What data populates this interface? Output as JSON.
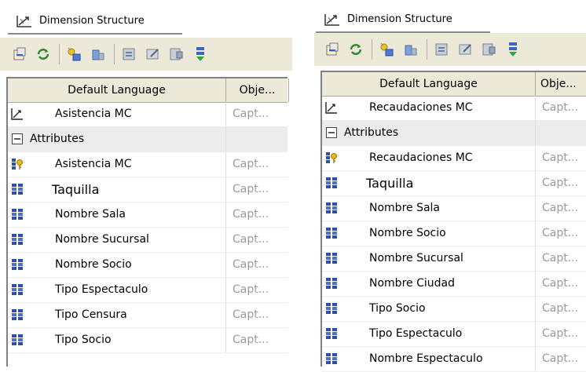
{
  "panels": [
    {
      "tab_title": "Dimension Structure",
      "headers": [
        "Default Language",
        "Obje..."
      ],
      "rows": [
        {
          "type": "dimension",
          "icon": "dimension-icon",
          "label": "Asistencia MC",
          "value": "Capt..."
        },
        {
          "type": "group",
          "icon": "collapse-icon",
          "label": "Attributes",
          "value": ""
        },
        {
          "type": "key",
          "icon": "key-attribute-icon",
          "label": "Asistencia MC",
          "value": "Capt..."
        },
        {
          "type": "attr",
          "icon": "attribute-icon",
          "label": "Taquilla",
          "value": "Capt..."
        },
        {
          "type": "attr",
          "icon": "attribute-icon",
          "label": "Nombre Sala",
          "value": "Capt..."
        },
        {
          "type": "attr",
          "icon": "attribute-icon",
          "label": "Nombre Sucursal",
          "value": "Capt..."
        },
        {
          "type": "attr",
          "icon": "attribute-icon",
          "label": "Nombre Socio",
          "value": "Capt..."
        },
        {
          "type": "attr",
          "icon": "attribute-icon",
          "label": "Tipo Espectaculo",
          "value": "Capt..."
        },
        {
          "type": "attr",
          "icon": "attribute-icon",
          "label": "Tipo Censura",
          "value": "Capt..."
        },
        {
          "type": "attr",
          "icon": "attribute-icon",
          "label": "Tipo Socio",
          "value": "Capt..."
        }
      ]
    },
    {
      "tab_title": "Dimension Structure",
      "headers": [
        "Default Language",
        "Obje..."
      ],
      "rows": [
        {
          "type": "dimension",
          "icon": "dimension-icon",
          "label": "Recaudaciones MC",
          "value": "Capt..."
        },
        {
          "type": "group",
          "icon": "collapse-icon",
          "label": "Attributes",
          "value": ""
        },
        {
          "type": "key",
          "icon": "key-attribute-icon",
          "label": "Recaudaciones MC",
          "value": "Capt..."
        },
        {
          "type": "attr",
          "icon": "attribute-icon",
          "label": "Taquilla",
          "value": "Capt..."
        },
        {
          "type": "attr",
          "icon": "attribute-icon",
          "label": "Nombre Sala",
          "value": "Capt..."
        },
        {
          "type": "attr",
          "icon": "attribute-icon",
          "label": "Nombre Socio",
          "value": "Capt..."
        },
        {
          "type": "attr",
          "icon": "attribute-icon",
          "label": "Nombre Sucursal",
          "value": "Capt..."
        },
        {
          "type": "attr",
          "icon": "attribute-icon",
          "label": "Nombre Ciudad",
          "value": "Capt..."
        },
        {
          "type": "attr",
          "icon": "attribute-icon",
          "label": "Tipo Socio",
          "value": "Capt..."
        },
        {
          "type": "attr",
          "icon": "attribute-icon",
          "label": "Tipo Espectaculo",
          "value": "Capt..."
        },
        {
          "type": "attr",
          "icon": "attribute-icon",
          "label": "Nombre Espectaculo",
          "value": "Capt..."
        }
      ]
    }
  ],
  "toolbar_icons": [
    "process-icon",
    "refresh-icon",
    "new-attribute-icon",
    "hierarchy-icon",
    "properties-icon",
    "edit-icon",
    "browse-icon",
    "move-down-icon"
  ]
}
